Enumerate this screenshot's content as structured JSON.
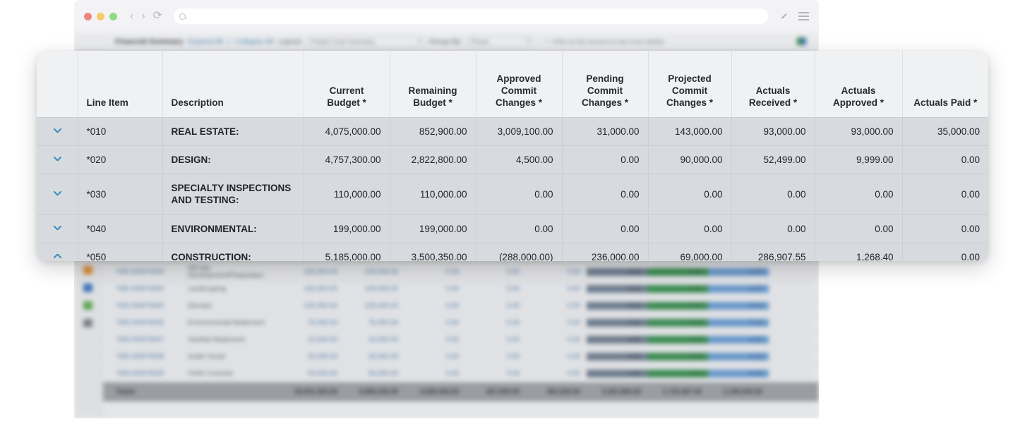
{
  "browser": {
    "traffic_lights": [
      "close",
      "minimize",
      "maximize"
    ],
    "back_glyph": "‹",
    "forward_glyph": "›",
    "reload_glyph": "⟳",
    "address_value": "",
    "address_placeholder": ""
  },
  "app_toolbar": {
    "title": "Financial Summary",
    "expand_all": "Expand All",
    "separator": "|",
    "collapse_all": "Collapse All",
    "layout_label": "Layout:",
    "layout_value": "Project Cost Summary",
    "group_by_label": "Group By:",
    "group_by_value": "Phase",
    "hint": "* - Click on the amount to see more details"
  },
  "table": {
    "columns": [
      {
        "key": "chev",
        "label": "",
        "align": "center"
      },
      {
        "key": "line",
        "label": "Line Item",
        "align": "left"
      },
      {
        "key": "desc",
        "label": "Description",
        "align": "left"
      },
      {
        "key": "curbud",
        "label": "Current\nBudget *",
        "align": "center"
      },
      {
        "key": "rembud",
        "label": "Remaining\nBudget *",
        "align": "center"
      },
      {
        "key": "appcc",
        "label": "Approved\nCommit\nChanges *",
        "align": "center"
      },
      {
        "key": "pendcc",
        "label": "Pending\nCommit\nChanges *",
        "align": "center"
      },
      {
        "key": "projcc",
        "label": "Projected\nCommit\nChanges *",
        "align": "center"
      },
      {
        "key": "actrec",
        "label": "Actuals\nReceived *",
        "align": "center"
      },
      {
        "key": "actapp",
        "label": "Actuals\nApproved *",
        "align": "center"
      },
      {
        "key": "actpaid",
        "label": "Actuals Paid *",
        "align": "center"
      }
    ],
    "rows": [
      {
        "expander": "chevron-down",
        "line_item": "*010",
        "description": "REAL ESTATE:",
        "current_budget": "4,075,000.00",
        "remaining_budget": "852,900.00",
        "approved_commit_changes": "3,009,100.00",
        "pending_commit_changes": "31,000.00",
        "projected_commit_changes": "143,000.00",
        "actuals_received": "93,000.00",
        "actuals_approved": "93,000.00",
        "actuals_paid": "35,000.00"
      },
      {
        "expander": "chevron-down",
        "line_item": "*020",
        "description": "DESIGN:",
        "current_budget": "4,757,300.00",
        "remaining_budget": "2,822,800.00",
        "approved_commit_changes": "4,500.00",
        "pending_commit_changes": "0.00",
        "projected_commit_changes": "90,000.00",
        "actuals_received": "52,499.00",
        "actuals_approved": "9,999.00",
        "actuals_paid": "0.00"
      },
      {
        "expander": "chevron-down",
        "line_item": "*030",
        "description": "SPECIALTY INSPECTIONS AND TESTING:",
        "current_budget": "110,000.00",
        "remaining_budget": "110,000.00",
        "approved_commit_changes": "0.00",
        "pending_commit_changes": "0.00",
        "projected_commit_changes": "0.00",
        "actuals_received": "0.00",
        "actuals_approved": "0.00",
        "actuals_paid": "0.00"
      },
      {
        "expander": "chevron-down",
        "line_item": "*040",
        "description": "ENVIRONMENTAL:",
        "current_budget": "199,000.00",
        "remaining_budget": "199,000.00",
        "approved_commit_changes": "0.00",
        "pending_commit_changes": "0.00",
        "projected_commit_changes": "0.00",
        "actuals_received": "0.00",
        "actuals_approved": "0.00",
        "actuals_paid": "0.00"
      },
      {
        "expander": "chevron-up",
        "line_item": "*050",
        "description": "CONSTRUCTION:",
        "current_budget": "5,185,000.00",
        "remaining_budget": "3,500,350.00",
        "approved_commit_changes": "(288,000.00)",
        "pending_commit_changes": "236,000.00",
        "projected_commit_changes": "69,000.00",
        "actuals_received": "286,907.55",
        "actuals_approved": "1,268.40",
        "actuals_paid": "0.00"
      }
    ]
  },
  "background_table": {
    "rows": [
      {
        "code": "*050.0000*5003",
        "desc": "Off-Site Development/Preparation",
        "v1": "100,000.00",
        "v2": "100,000.00",
        "v3": "0.00",
        "v4": "0.00",
        "v5": "0.00",
        "v6": "0.00",
        "v7": "0.00",
        "v8": "0.00"
      },
      {
        "code": "*050.0000*5004",
        "desc": "Landscaping",
        "v1": "100,000.00",
        "v2": "100,000.00",
        "v3": "0.00",
        "v4": "0.00",
        "v5": "0.00",
        "v6": "0.00",
        "v7": "0.00",
        "v8": "0.00"
      },
      {
        "code": "*050.0000*5005",
        "desc": "Elevator",
        "v1": "125,000.00",
        "v2": "125,000.00",
        "v3": "0.00",
        "v4": "0.00",
        "v5": "0.00",
        "v6": "0.00",
        "v7": "0.00",
        "v8": "0.00"
      },
      {
        "code": "*050.0000*5006",
        "desc": "Environmental Abatement",
        "v1": "75,000.00",
        "v2": "75,000.00",
        "v3": "0.00",
        "v4": "0.00",
        "v5": "0.00",
        "v6": "0.00",
        "v7": "0.00",
        "v8": "0.00"
      },
      {
        "code": "*050.0000*5007",
        "desc": "HazMat Abatement",
        "v1": "10,000.00",
        "v2": "10,000.00",
        "v3": "0.00",
        "v4": "0.00",
        "v5": "0.00",
        "v6": "0.00",
        "v7": "0.00",
        "v8": "0.00"
      },
      {
        "code": "*050.0000*5008",
        "desc": "Audio Visual",
        "v1": "25,000.00",
        "v2": "25,000.00",
        "v3": "0.00",
        "v4": "0.00",
        "v5": "0.00",
        "v6": "0.00",
        "v7": "0.00",
        "v8": "0.00"
      },
      {
        "code": "*050.0000*5009",
        "desc": "HVAC Controls",
        "v1": "50,000.00",
        "v2": "50,000.00",
        "v3": "0.00",
        "v4": "0.00",
        "v5": "0.00",
        "v6": "0.00",
        "v7": "0.00",
        "v8": "0.00"
      }
    ],
    "totals": {
      "label": "Totals",
      "v1": "26,531,300.00",
      "v2": "9,585,250.00",
      "v3": "4,699,400.00",
      "v4": "267,000.00",
      "v5": "381,500.00",
      "v6": "2,391,806.55",
      "v7": "1,710,467.40",
      "v8": "1,185,000.00"
    }
  },
  "colors": {
    "panel_bg": "#eff1f3",
    "row_bg": "#d7dade",
    "chevron_blue": "#3b8cc0",
    "highlight_slate": "#6d7c8d",
    "highlight_green": "#3b8a52",
    "highlight_blue": "#6897c9"
  }
}
